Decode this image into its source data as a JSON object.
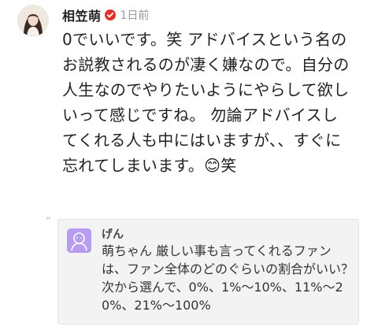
{
  "post": {
    "author": "相笠萌",
    "time": "1日前",
    "text": "0でいいです。笑 アドバイスという名のお説教されるのが凄く嫌なので。自分の人生なのでやりたいようにやらして欲しいって感じですね。 勿論アドバイスしてくれる人も中にはいますが、、すぐに忘れてしまいます。😊笑",
    "verified_icon": "verified-badge-icon",
    "avatar_icon": "user-avatar-photo"
  },
  "reply": {
    "name": "げん",
    "text": "萌ちゃん 厳しい事も言ってくれるファンは、ファン全体のどのぐらいの割合がいい？ 次から選んで、0%、1%〜10%、11%〜20%、21%〜100%",
    "quote_mark": "“",
    "avatar_icon": "default-user-avatar-icon"
  },
  "colors": {
    "badge": "#e0312b",
    "time": "#9a9a9a",
    "reply_bg": "#f3f3f3",
    "reply_avatar": "#b79cef"
  }
}
